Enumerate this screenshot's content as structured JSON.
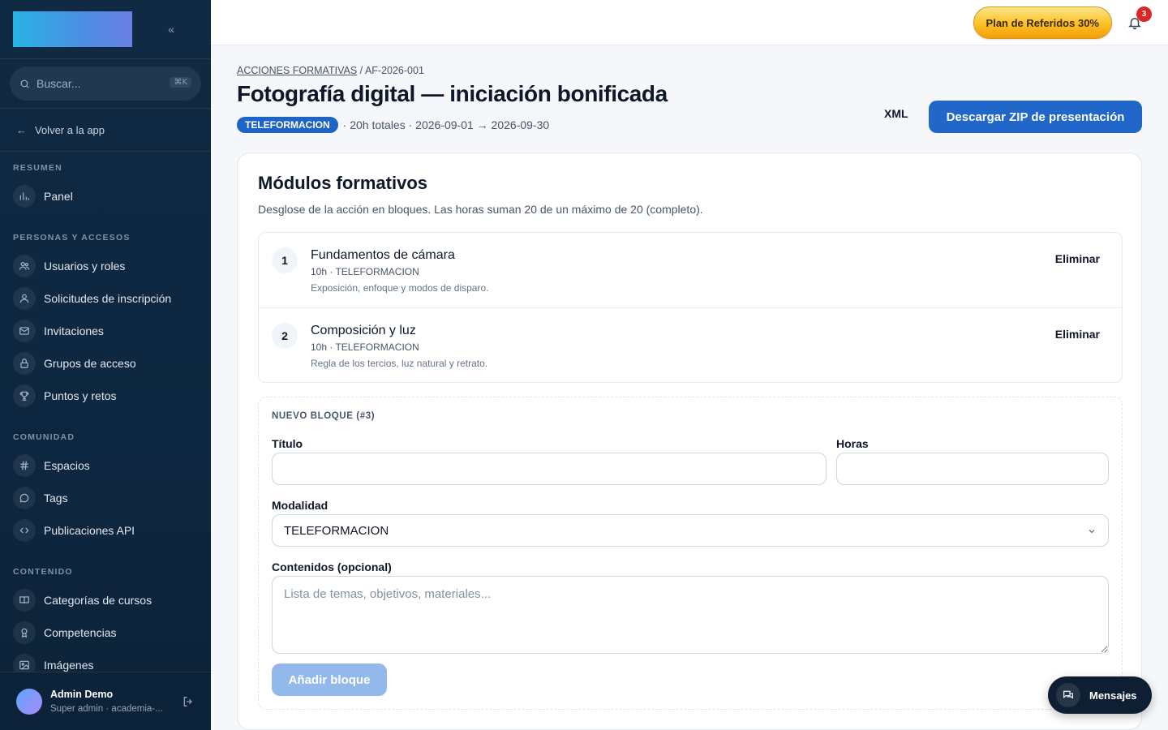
{
  "sidebar": {
    "collapse_glyph": "«",
    "search": {
      "placeholder": "Buscar...",
      "shortcut": "⌘K"
    },
    "back_label": "Volver a la app",
    "sections": [
      {
        "title": "RESUMEN",
        "items": [
          {
            "label": "Panel",
            "icon": "bar-chart-icon"
          }
        ]
      },
      {
        "title": "PERSONAS Y ACCESOS",
        "items": [
          {
            "label": "Usuarios y roles",
            "icon": "users-icon"
          },
          {
            "label": "Solicitudes de inscripción",
            "icon": "user-icon"
          },
          {
            "label": "Invitaciones",
            "icon": "mail-icon"
          },
          {
            "label": "Grupos de acceso",
            "icon": "lock-icon"
          },
          {
            "label": "Puntos y retos",
            "icon": "trophy-icon"
          }
        ]
      },
      {
        "title": "COMUNIDAD",
        "items": [
          {
            "label": "Espacios",
            "icon": "hash-icon"
          },
          {
            "label": "Tags",
            "icon": "chat-bubble-icon"
          },
          {
            "label": "Publicaciones API",
            "icon": "code-icon"
          }
        ]
      },
      {
        "title": "CONTENIDO",
        "items": [
          {
            "label": "Categorías de cursos",
            "icon": "book-open-icon"
          },
          {
            "label": "Competencias",
            "icon": "award-icon"
          },
          {
            "label": "Imágenes",
            "icon": "image-icon"
          }
        ]
      }
    ],
    "user": {
      "name": "Admin Demo",
      "role": "Super admin · academia-..."
    }
  },
  "topbar": {
    "referral_label": "Plan de Referidos 30%",
    "notification_count": "3"
  },
  "header": {
    "breadcrumb_link": "ACCIONES FORMATIVAS",
    "breadcrumb_sep": "/",
    "breadcrumb_current": "AF-2026-001",
    "title": "Fotografía digital — iniciación bonificada",
    "modality": "TELEFORMACION",
    "meta": "· 20h totales · 2026-09-01 → 2026-09-30",
    "xml_label": "XML",
    "zip_label": "Descargar ZIP de presentación"
  },
  "modules_card": {
    "title": "Módulos formativos",
    "description": "Desglose de la acción en bloques. Las horas suman 20 de un máximo de 20 (completo).",
    "modules": [
      {
        "number": "1",
        "title": "Fundamentos de cámara",
        "meta": "10h · TELEFORMACION",
        "description": "Exposición, enfoque y modos de disparo.",
        "delete_label": "Eliminar"
      },
      {
        "number": "2",
        "title": "Composición y luz",
        "meta": "10h · TELEFORMACION",
        "description": "Regla de los tercios, luz natural y retrato.",
        "delete_label": "Eliminar"
      }
    ],
    "new_block": {
      "label": "NUEVO BLOQUE (#3)",
      "title_label": "Título",
      "title_value": "",
      "hours_label": "Horas",
      "hours_value": "",
      "modality_label": "Modalidad",
      "modality_value": "TELEFORMACION",
      "contents_label": "Contenidos (opcional)",
      "contents_placeholder": "Lista de temas, objetivos, materiales...",
      "add_label": "Añadir bloque"
    }
  },
  "messages_label": "Mensajes"
}
